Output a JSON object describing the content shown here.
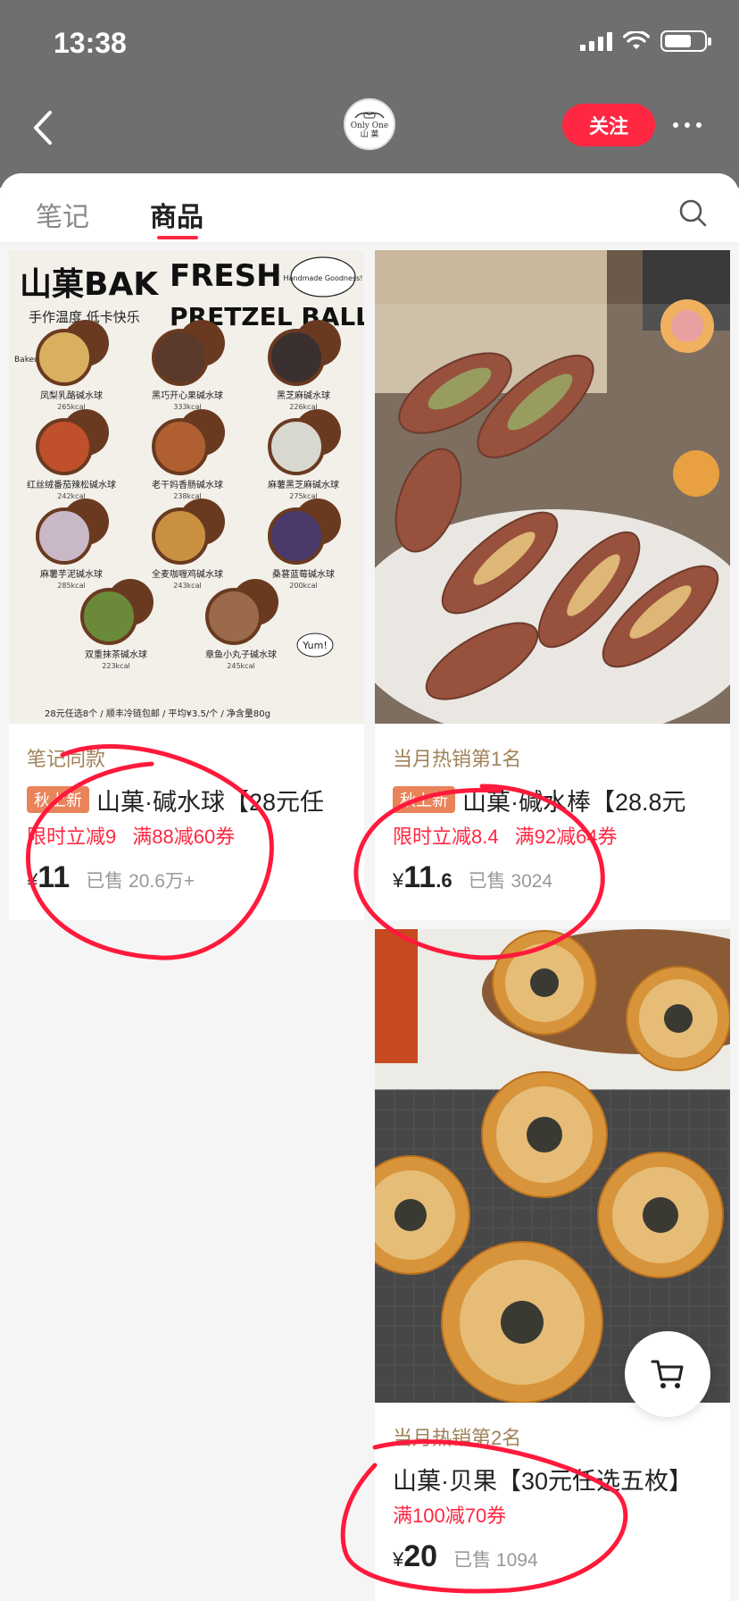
{
  "status_bar": {
    "time": "13:38"
  },
  "header": {
    "shop_logo_text": [
      "Only One",
      "山 菓"
    ],
    "follow_label": "关注"
  },
  "tabs": [
    {
      "label": "笔记",
      "active": false
    },
    {
      "label": "商品",
      "active": true
    }
  ],
  "products": [
    {
      "poster": {
        "title_left": "山菓BAK",
        "title_right_1": "FRESH",
        "title_right_2": "PRETZEL BALL",
        "subtitle": "手作温度 低卡快乐",
        "bubble": "Handmade Goodness!",
        "side": "Baked Fresh Daily!",
        "items": [
          {
            "name": "凤梨乳酪碱水球",
            "kcal": "265kcal",
            "color": "#d8b060"
          },
          {
            "name": "黑巧开心果碱水球",
            "kcal": "333kcal",
            "color": "#5a3a2a"
          },
          {
            "name": "黑芝麻碱水球",
            "kcal": "226kcal",
            "color": "#3a3030"
          },
          {
            "name": "红丝绒番茄辣松碱水球",
            "kcal": "242kcal",
            "color": "#c0502c"
          },
          {
            "name": "老干妈香肠碱水球",
            "kcal": "238kcal",
            "color": "#b06030"
          },
          {
            "name": "麻薯黑芝麻碱水球",
            "kcal": "275kcal",
            "color": "#d8d8d0"
          },
          {
            "name": "麻薯芋泥碱水球",
            "kcal": "285kcal",
            "color": "#c8b8c8"
          },
          {
            "name": "全麦咖喱鸡碱水球",
            "kcal": "243kcal",
            "color": "#c89040"
          },
          {
            "name": "桑葚蓝莓碱水球",
            "kcal": "200kcal",
            "color": "#4a3a6a"
          },
          {
            "name": "双重抹茶碱水球",
            "kcal": "223kcal",
            "color": "#6a8a3a"
          },
          {
            "name": "章鱼小丸子碱水球",
            "kcal": "245kcal",
            "color": "#9a6a4a"
          }
        ],
        "footer": "28元任选8个 / 顺丰冷链包邮 / 平均¥3.5/个 / 净含量80g",
        "yum": "Yum!"
      },
      "rank": "笔记同款",
      "badge": "秋上新",
      "title": "山菓·碱水球【28元任",
      "promos": [
        "限时立减9",
        "满88减60券"
      ],
      "currency": "¥",
      "price_int": "11",
      "price_dec": "",
      "sold": "已售 20.6万+"
    },
    {
      "rank": "当月热销第1名",
      "badge": "秋上新",
      "title": "山菓·碱水棒【28.8元",
      "promos": [
        "限时立减8.4",
        "满92减64券"
      ],
      "currency": "¥",
      "price_int": "11",
      "price_dec": ".6",
      "sold": "已售 3024"
    },
    {
      "rank": "当月热销第2名",
      "badge": "",
      "title": "山菓·贝果【30元任选五枚】",
      "promos": [
        "满100减70券"
      ],
      "currency": "¥",
      "price_int": "20",
      "price_dec": "",
      "sold": "已售 1094"
    }
  ],
  "colors": {
    "accent": "#ff2742",
    "rank_text": "#a0825a",
    "new_badge": "#e8835a",
    "annotation": "#ff1a3c"
  }
}
